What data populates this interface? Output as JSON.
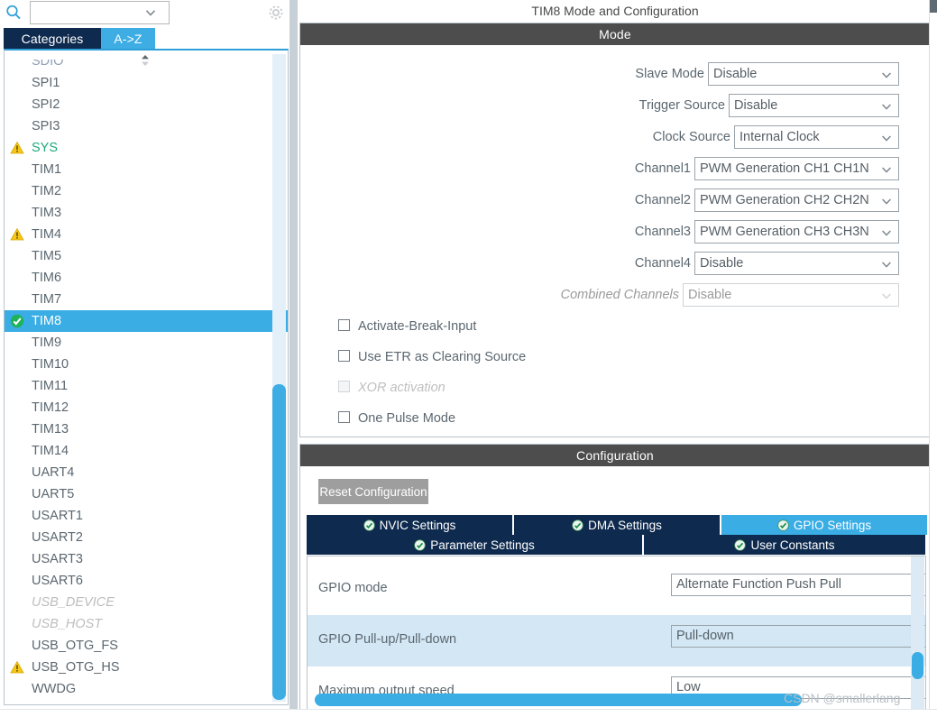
{
  "sidebar": {
    "search": {
      "value": "",
      "placeholder": "",
      "icon": "search-icon",
      "chevron": "chevron-down-icon"
    },
    "gear_icon": "gear-icon",
    "tabs": [
      {
        "label": "Categories",
        "active": false
      },
      {
        "label": "A->Z",
        "active": true
      }
    ],
    "sort_icon": "sort-updown-icon",
    "items": [
      {
        "label": "SDIO",
        "state": "none",
        "style": "cut"
      },
      {
        "label": "SPI1",
        "state": "none",
        "style": "normal"
      },
      {
        "label": "SPI2",
        "state": "none",
        "style": "normal"
      },
      {
        "label": "SPI3",
        "state": "none",
        "style": "normal"
      },
      {
        "label": "SYS",
        "state": "warning",
        "style": "green"
      },
      {
        "label": "TIM1",
        "state": "none",
        "style": "normal"
      },
      {
        "label": "TIM2",
        "state": "none",
        "style": "normal"
      },
      {
        "label": "TIM3",
        "state": "none",
        "style": "normal"
      },
      {
        "label": "TIM4",
        "state": "warning",
        "style": "normal"
      },
      {
        "label": "TIM5",
        "state": "none",
        "style": "normal"
      },
      {
        "label": "TIM6",
        "state": "none",
        "style": "normal"
      },
      {
        "label": "TIM7",
        "state": "none",
        "style": "normal"
      },
      {
        "label": "TIM8",
        "state": "ok",
        "style": "selected"
      },
      {
        "label": "TIM9",
        "state": "none",
        "style": "normal"
      },
      {
        "label": "TIM10",
        "state": "none",
        "style": "normal"
      },
      {
        "label": "TIM11",
        "state": "none",
        "style": "normal"
      },
      {
        "label": "TIM12",
        "state": "none",
        "style": "normal"
      },
      {
        "label": "TIM13",
        "state": "none",
        "style": "normal"
      },
      {
        "label": "TIM14",
        "state": "none",
        "style": "normal"
      },
      {
        "label": "UART4",
        "state": "none",
        "style": "normal"
      },
      {
        "label": "UART5",
        "state": "none",
        "style": "normal"
      },
      {
        "label": "USART1",
        "state": "none",
        "style": "normal"
      },
      {
        "label": "USART2",
        "state": "none",
        "style": "normal"
      },
      {
        "label": "USART3",
        "state": "none",
        "style": "normal"
      },
      {
        "label": "USART6",
        "state": "none",
        "style": "normal"
      },
      {
        "label": "USB_DEVICE",
        "state": "none",
        "style": "disabled"
      },
      {
        "label": "USB_HOST",
        "state": "none",
        "style": "disabled"
      },
      {
        "label": "USB_OTG_FS",
        "state": "none",
        "style": "normal"
      },
      {
        "label": "USB_OTG_HS",
        "state": "warning",
        "style": "normal"
      },
      {
        "label": "WWDG",
        "state": "none",
        "style": "normal"
      }
    ]
  },
  "main": {
    "title": "TIM8 Mode and Configuration",
    "mode": {
      "header": "Mode",
      "rows": [
        {
          "label": "Slave Mode",
          "value": "Disable",
          "disabled": false
        },
        {
          "label": "Trigger Source",
          "value": "Disable",
          "disabled": false
        },
        {
          "label": "Clock Source",
          "value": "Internal Clock",
          "disabled": false
        },
        {
          "label": "Channel1",
          "value": "PWM Generation CH1 CH1N",
          "disabled": false
        },
        {
          "label": "Channel2",
          "value": "PWM Generation CH2 CH2N",
          "disabled": false
        },
        {
          "label": "Channel3",
          "value": "PWM Generation CH3 CH3N",
          "disabled": false
        },
        {
          "label": "Channel4",
          "value": "Disable",
          "disabled": false
        },
        {
          "label": "Combined Channels",
          "value": "Disable",
          "disabled": true
        }
      ],
      "checkboxes": [
        {
          "label": "Activate-Break-Input",
          "checked": false,
          "disabled": false
        },
        {
          "label": "Use ETR as Clearing Source",
          "checked": false,
          "disabled": false
        },
        {
          "label": "XOR activation",
          "checked": false,
          "disabled": true
        },
        {
          "label": "One Pulse Mode",
          "checked": false,
          "disabled": false
        }
      ]
    },
    "configuration": {
      "header": "Configuration",
      "reset_label": "Reset Configuration",
      "tabs_row1": [
        {
          "label": "NVIC Settings",
          "active": false,
          "icon": "check-circle-icon"
        },
        {
          "label": "DMA Settings",
          "active": false,
          "icon": "check-circle-icon"
        },
        {
          "label": "GPIO Settings",
          "active": true,
          "icon": "check-circle-icon"
        }
      ],
      "tabs_row2": [
        {
          "label": "Parameter Settings",
          "active": false,
          "icon": "check-circle-icon"
        },
        {
          "label": "User Constants",
          "active": false,
          "icon": "check-circle-icon"
        }
      ],
      "gpio_rows": [
        {
          "label": "GPIO mode",
          "value": "Alternate Function Push Pull",
          "highlighted": false
        },
        {
          "label": "GPIO Pull-up/Pull-down",
          "value": "Pull-down",
          "highlighted": true
        },
        {
          "label": "Maximum output speed",
          "value": "Low",
          "highlighted": false
        }
      ]
    }
  },
  "watermark": "CSDN @smallerlang",
  "colors": {
    "accent_blue": "#39ade4",
    "navy": "#0e2a4e",
    "panel_header": "#4d4d4d",
    "warning_yellow": "#f5c518",
    "ok_green": "#1eb25a",
    "highlight_row": "#d4e7f5"
  }
}
